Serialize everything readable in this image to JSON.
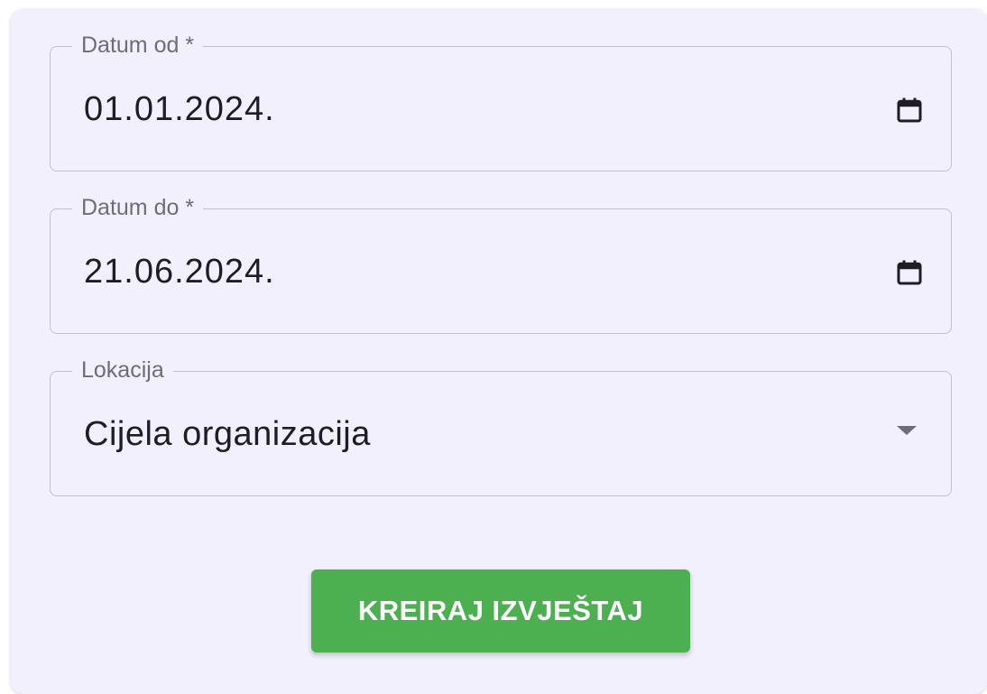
{
  "form": {
    "date_from": {
      "label": "Datum od *",
      "value": "01.01.2024.",
      "icon": "calendar-icon"
    },
    "date_to": {
      "label": "Datum do *",
      "value": "21.06.2024.",
      "icon": "calendar-icon"
    },
    "location": {
      "label": "Lokacija",
      "selected": "Cijela organizacija",
      "icon": "chevron-down-icon"
    },
    "submit_label": "KREIRAJ IZVJEŠTAJ"
  },
  "colors": {
    "card_background": "#f2f0fd",
    "border": "#c3c0cc",
    "label": "#6f6c78",
    "text": "#1f1d24",
    "button": "#4caf50",
    "button_text": "#ffffff"
  }
}
